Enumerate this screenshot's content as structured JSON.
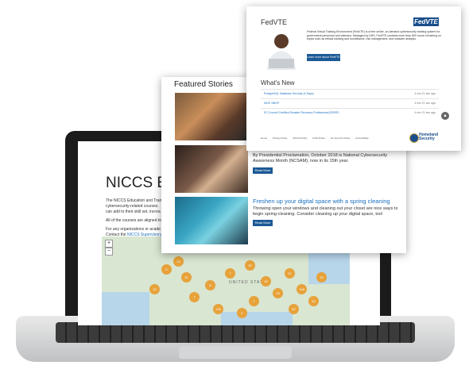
{
  "niccs": {
    "title": "NICCS Educ",
    "para1_line1": "The NICCS Education and Train",
    "para1_line2": "cybersecurity-related courses.",
    "para1_line3": "can add to their skill set, increa",
    "para2": "All of the courses are aligned to",
    "para3_line1": "For any organizations or acade",
    "para3_line2_prefix": "Contact the ",
    "para3_link": "NICCS Supervisory",
    "map": {
      "zoom_in": "+",
      "zoom_out": "−",
      "country_label": "UNITED STATES",
      "clusters": [
        "6",
        "13",
        "31",
        "7",
        "8",
        "7",
        "20",
        "10",
        "13",
        "21",
        "148",
        "43",
        "52",
        "7",
        "2",
        "139",
        "12",
        "15"
      ]
    }
  },
  "featured": {
    "title": "Featured Stories",
    "stories": [
      {
        "title": "",
        "body": "By Presidential Proclamation, October 2018 is National Cybersecurity Awareness Month (NCSAM), now in its 15th year.",
        "button": "Read More"
      },
      {
        "title": "Freshen up your digital space with a spring cleaning",
        "body": "Throwing open your windows and cleaning out your closet are nice ways to begin spring-cleaning. Consider cleaning up your digital space, too!",
        "button": "Read More"
      }
    ]
  },
  "fedvte": {
    "title": "FedVTE",
    "logo": "FedVTE",
    "description": "Federal Virtual Training Environment (FedVTE) is a free online, on-demand cybersecurity training system for government personnel and veterans. Managed by DHS, FedVTE contains more than 800 hours of training on topics such as ethical hacking and surveillance, risk management, and malware analysis.",
    "button": "Learn more about FedVTE",
    "whats_new": {
      "title": "What's New",
      "items": [
        {
          "title": "PostgreSQL Database Security (4 Days)",
          "time": "4 min 21 sec ago"
        },
        {
          "title": "NICE SBOP",
          "time": "4 min 21 sec ago"
        },
        {
          "title": "EC-Council Certified Disaster Recovery Professional (EDRP)",
          "time": "4 min 21 sec ago"
        }
      ]
    },
    "footer": [
      "Home",
      "Privacy Policy",
      "NICCS Policy",
      "FOIA Policy",
      "No Fear Act Policy",
      "Accessibility"
    ],
    "dhs": {
      "line1": "Homeland",
      "line2": "Security"
    },
    "scroll_icon": "chevron-up-icon"
  },
  "colors": {
    "link": "#1a6fbf",
    "button": "#1c5a96",
    "accent_cluster": "#e7a23b",
    "dhs_blue": "#1a4e8c"
  }
}
